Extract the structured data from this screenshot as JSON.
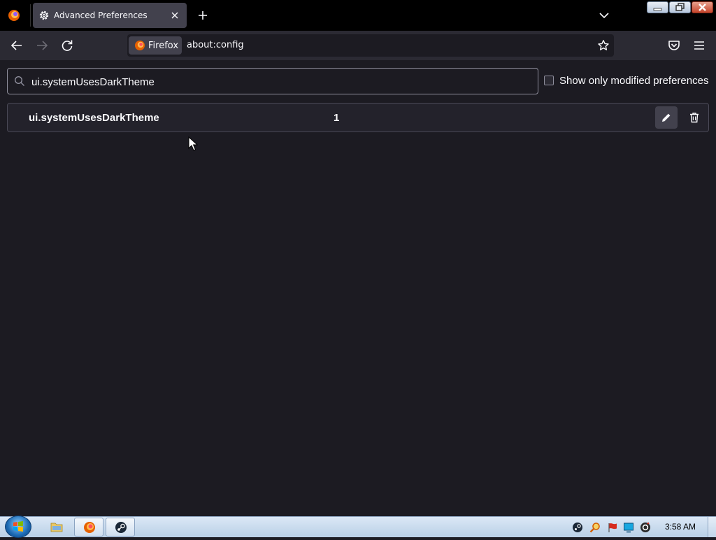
{
  "tab": {
    "title": "Advanced Preferences",
    "icon": "gear-icon"
  },
  "urlbar": {
    "identity_label": "Firefox",
    "url": "about:config"
  },
  "config": {
    "search": {
      "value": "ui.systemUsesDarkTheme"
    },
    "modified_only_label": "Show only modified preferences",
    "modified_only_checked": false,
    "row": {
      "name": "ui.systemUsesDarkTheme",
      "value": "1"
    }
  },
  "taskbar": {
    "clock": "3:58 AM"
  },
  "colors": {
    "page_bg": "#1c1b22",
    "toolbar_bg": "#2b2a33",
    "tab_active_bg": "#42414d"
  }
}
